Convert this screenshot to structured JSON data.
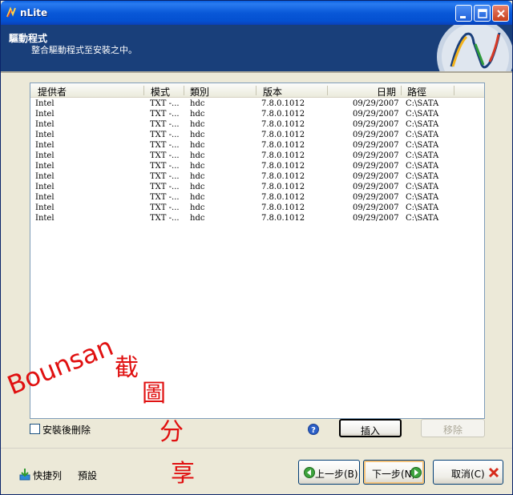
{
  "window": {
    "title": "nLite"
  },
  "header": {
    "title": "驅動程式",
    "subtitle": "整合驅動程式至安裝之中。"
  },
  "table": {
    "columns": [
      "提供者",
      "模式",
      "類別",
      "版本",
      "日期",
      "路徑"
    ],
    "rows": [
      [
        "Intel",
        "TXT -...",
        "hdc",
        "7.8.0.1012",
        "09/29/2007",
        "C:\\SATA"
      ],
      [
        "Intel",
        "TXT -...",
        "hdc",
        "7.8.0.1012",
        "09/29/2007",
        "C:\\SATA"
      ],
      [
        "Intel",
        "TXT -...",
        "hdc",
        "7.8.0.1012",
        "09/29/2007",
        "C:\\SATA"
      ],
      [
        "Intel",
        "TXT -...",
        "hdc",
        "7.8.0.1012",
        "09/29/2007",
        "C:\\SATA"
      ],
      [
        "Intel",
        "TXT -...",
        "hdc",
        "7.8.0.1012",
        "09/29/2007",
        "C:\\SATA"
      ],
      [
        "Intel",
        "TXT -...",
        "hdc",
        "7.8.0.1012",
        "09/29/2007",
        "C:\\SATA"
      ],
      [
        "Intel",
        "TXT -...",
        "hdc",
        "7.8.0.1012",
        "09/29/2007",
        "C:\\SATA"
      ],
      [
        "Intel",
        "TXT -...",
        "hdc",
        "7.8.0.1012",
        "09/29/2007",
        "C:\\SATA"
      ],
      [
        "Intel",
        "TXT -...",
        "hdc",
        "7.8.0.1012",
        "09/29/2007",
        "C:\\SATA"
      ],
      [
        "Intel",
        "TXT -...",
        "hdc",
        "7.8.0.1012",
        "09/29/2007",
        "C:\\SATA"
      ],
      [
        "Intel",
        "TXT -...",
        "hdc",
        "7.8.0.1012",
        "09/29/2007",
        "C:\\SATA"
      ],
      [
        "Intel",
        "TXT -...",
        "hdc",
        "7.8.0.1012",
        "09/29/2007",
        "C:\\SATA"
      ]
    ]
  },
  "options": {
    "delete_after_install": "安裝後刪除",
    "checked": false
  },
  "buttons": {
    "insert": "插入",
    "remove": "移除"
  },
  "footer": {
    "shortcut": "快捷列",
    "defaults": "預設",
    "back": "上一步(B)",
    "next": "下一步(N)",
    "cancel": "取消(C)"
  },
  "watermark": {
    "text": "Bounsan 截圖分享"
  },
  "colors": {
    "header_bg": "#193f7a",
    "titlebar": "#0958d8",
    "watermark": "#e01010"
  }
}
